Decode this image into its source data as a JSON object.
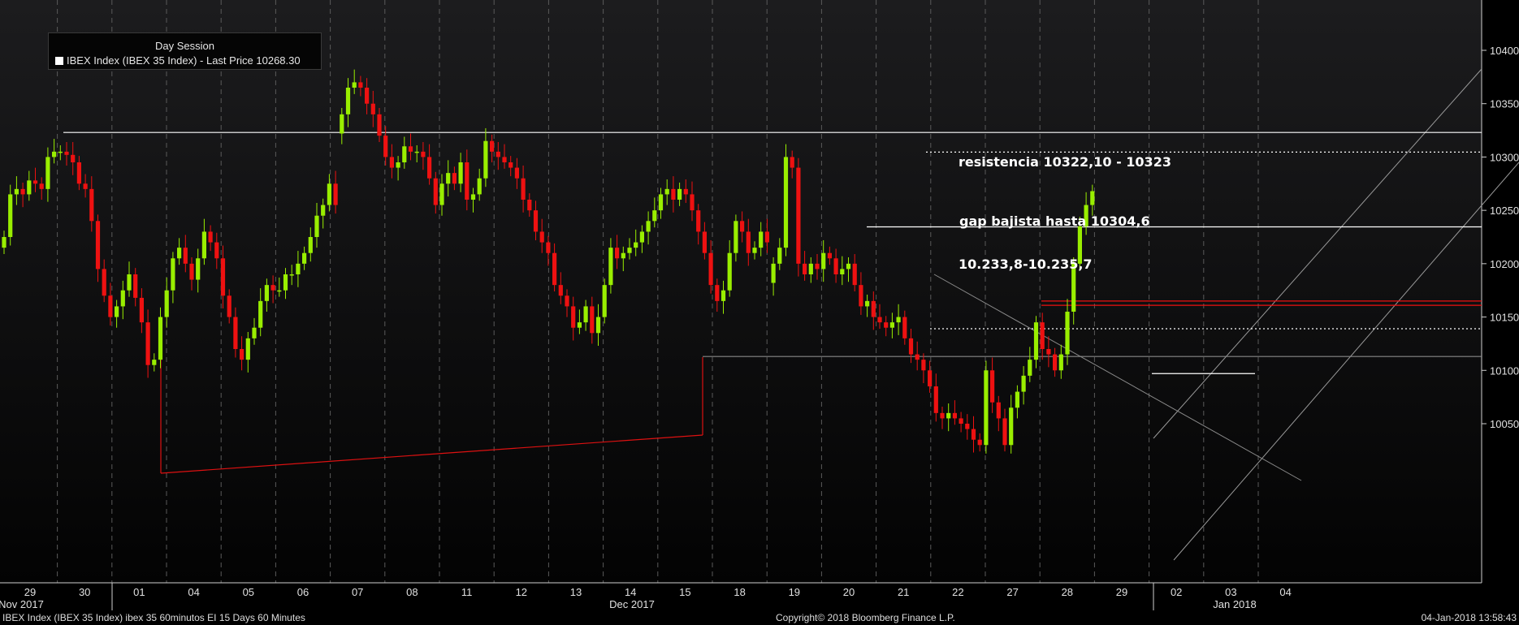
{
  "legend": {
    "session": "Day Session",
    "series": "IBEX Index (IBEX 35 Index) - Last Price 10268.30"
  },
  "annotations": {
    "resistance": "resistencia 10322,10 - 10323",
    "gap": "gap bajista hasta 10304,6",
    "range": "10.233,8-10.235,7"
  },
  "footer": {
    "left": "IBEX Index (IBEX 35 Index) ibex 35 60minutos EI 15 Days 60 Minutes",
    "center": "Copyright© 2018 Bloomberg Finance L.P.",
    "right": "04-Jan-2018 13:58:43"
  },
  "colors": {
    "up": "#99ee00",
    "down": "#ee1111",
    "background": "#000000"
  },
  "chart_data": {
    "type": "candlestick",
    "ylim": [
      10010,
      10425
    ],
    "yticks": [
      10050,
      10100,
      10150,
      10200,
      10250,
      10300,
      10350,
      10400
    ],
    "sessions": [
      "29",
      "30",
      "01",
      "04",
      "05",
      "06",
      "07",
      "08",
      "11",
      "12",
      "13",
      "14",
      "15",
      "18",
      "19",
      "20",
      "21",
      "22",
      "27",
      "28",
      "29",
      "02",
      "03",
      "04"
    ],
    "month_labels": [
      {
        "label": "Nov 2017",
        "at": 0
      },
      {
        "label": "Dec 2017",
        "at": 2
      },
      {
        "label": "Jan 2018",
        "at": 21
      }
    ],
    "closes": [
      10225,
      10265,
      10270,
      10265,
      10278,
      10275,
      10270,
      10300,
      10305,
      10305,
      10302,
      10295,
      10275,
      10270,
      10240,
      10195,
      10170,
      10150,
      10160,
      10175,
      10190,
      10168,
      10145,
      10105,
      10110,
      10150,
      10175,
      10205,
      10215,
      10200,
      10185,
      10205,
      10230,
      10220,
      10205,
      10170,
      10150,
      10120,
      10110,
      10130,
      10140,
      10165,
      10180,
      10175,
      10175,
      10190,
      10190,
      10200,
      10210,
      10225,
      10245,
      10255,
      10275,
      10255,
      10340,
      10365,
      10370,
      10365,
      10350,
      10340,
      10320,
      10300,
      10290,
      10295,
      10310,
      10305,
      10305,
      10300,
      10280,
      10255,
      10275,
      10285,
      10275,
      10295,
      10260,
      10265,
      10280,
      10315,
      10305,
      10300,
      10295,
      10290,
      10280,
      10260,
      10250,
      10230,
      10220,
      10210,
      10180,
      10170,
      10160,
      10140,
      10145,
      10160,
      10135,
      10150,
      10180,
      10215,
      10205,
      10210,
      10215,
      10220,
      10230,
      10240,
      10250,
      10265,
      10270,
      10260,
      10270,
      10265,
      10250,
      10230,
      10210,
      10180,
      10165,
      10175,
      10210,
      10240,
      10230,
      10210,
      10215,
      10230,
      10220,
      10200,
      10215,
      10300,
      10290,
      10200,
      10190,
      10200,
      10195,
      10210,
      10205,
      10190,
      10195,
      10200,
      10180,
      10160,
      10165,
      10150,
      10145,
      10140,
      10145,
      10150,
      10130,
      10115,
      10110,
      10100,
      10085,
      10060,
      10055,
      10060,
      10055,
      10050,
      10045,
      10035,
      10030,
      10100,
      10070,
      10055,
      10030,
      10065,
      10080,
      10095,
      10110,
      10145,
      10120,
      10115,
      10100,
      10115,
      10155,
      10200,
      10235,
      10255,
      10268
    ],
    "gaps_after_index": [
      53,
      122
    ],
    "horizontal_levels": [
      {
        "value": 10323,
        "color": "#ffffff",
        "style": "solid"
      },
      {
        "value": 10304.6,
        "color": "#ffffff",
        "style": "dotted"
      },
      {
        "value": 10234.5,
        "color": "#ffffff",
        "style": "solid"
      },
      {
        "value": 10165,
        "color": "#ee1111",
        "style": "solid"
      },
      {
        "value": 10161,
        "color": "#ee1111",
        "style": "solid"
      },
      {
        "value": 10139,
        "color": "#ffffff",
        "style": "dotted"
      },
      {
        "value": 10113,
        "color": "#888888",
        "style": "solid"
      },
      {
        "value": 10097,
        "color": "#ffffff",
        "style": "solid"
      }
    ]
  }
}
